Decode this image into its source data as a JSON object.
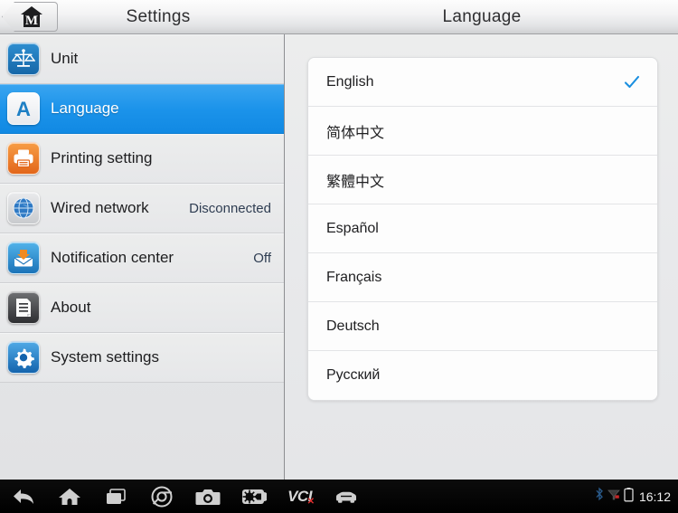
{
  "window": {
    "left_title": "Settings",
    "right_title": "Language"
  },
  "home_button": {
    "name": "home-m-button",
    "glyph_letter": "M"
  },
  "sidebar": {
    "items": [
      {
        "label": "Unit",
        "value": "",
        "icon": "scales-icon",
        "selected": false
      },
      {
        "label": "Language",
        "value": "",
        "icon": "letter-a-icon",
        "selected": true
      },
      {
        "label": "Printing setting",
        "value": "",
        "icon": "printer-icon",
        "selected": false
      },
      {
        "label": "Wired network",
        "value": "Disconnected",
        "icon": "globe-icon",
        "selected": false
      },
      {
        "label": "Notification center",
        "value": "Off",
        "icon": "inbox-arrow-icon",
        "selected": false
      },
      {
        "label": "About",
        "value": "",
        "icon": "document-icon",
        "selected": false
      },
      {
        "label": "System settings",
        "value": "",
        "icon": "gear-icon",
        "selected": false
      }
    ]
  },
  "language_list": {
    "items": [
      {
        "label": "English",
        "checked": true
      },
      {
        "label": "简体中文",
        "checked": false
      },
      {
        "label": "繁體中文",
        "checked": false
      },
      {
        "label": "Español",
        "checked": false
      },
      {
        "label": "Français",
        "checked": false
      },
      {
        "label": "Deutsch",
        "checked": false
      },
      {
        "label": "Русский",
        "checked": false
      }
    ]
  },
  "navbar": {
    "buttons": [
      {
        "name": "back-arrow-icon",
        "label": ""
      },
      {
        "name": "home-icon",
        "label": ""
      },
      {
        "name": "recent-apps-icon",
        "label": ""
      },
      {
        "name": "chrome-browser-icon",
        "label": ""
      },
      {
        "name": "camera-icon",
        "label": ""
      },
      {
        "name": "screenshot-icon",
        "label": ""
      },
      {
        "name": "vci-icon",
        "label": "VCI"
      },
      {
        "name": "vehicle-icon",
        "label": ""
      }
    ],
    "status": {
      "bluetooth": "bluetooth-icon",
      "signal": "signal-icon",
      "battery": "battery-icon",
      "clock": "16:12"
    }
  },
  "colors": {
    "accent_blue": "#1b93ea",
    "check_blue": "#1a8fe0",
    "navbar_black": "#000000",
    "panel_bg": "#e8e9eb"
  }
}
